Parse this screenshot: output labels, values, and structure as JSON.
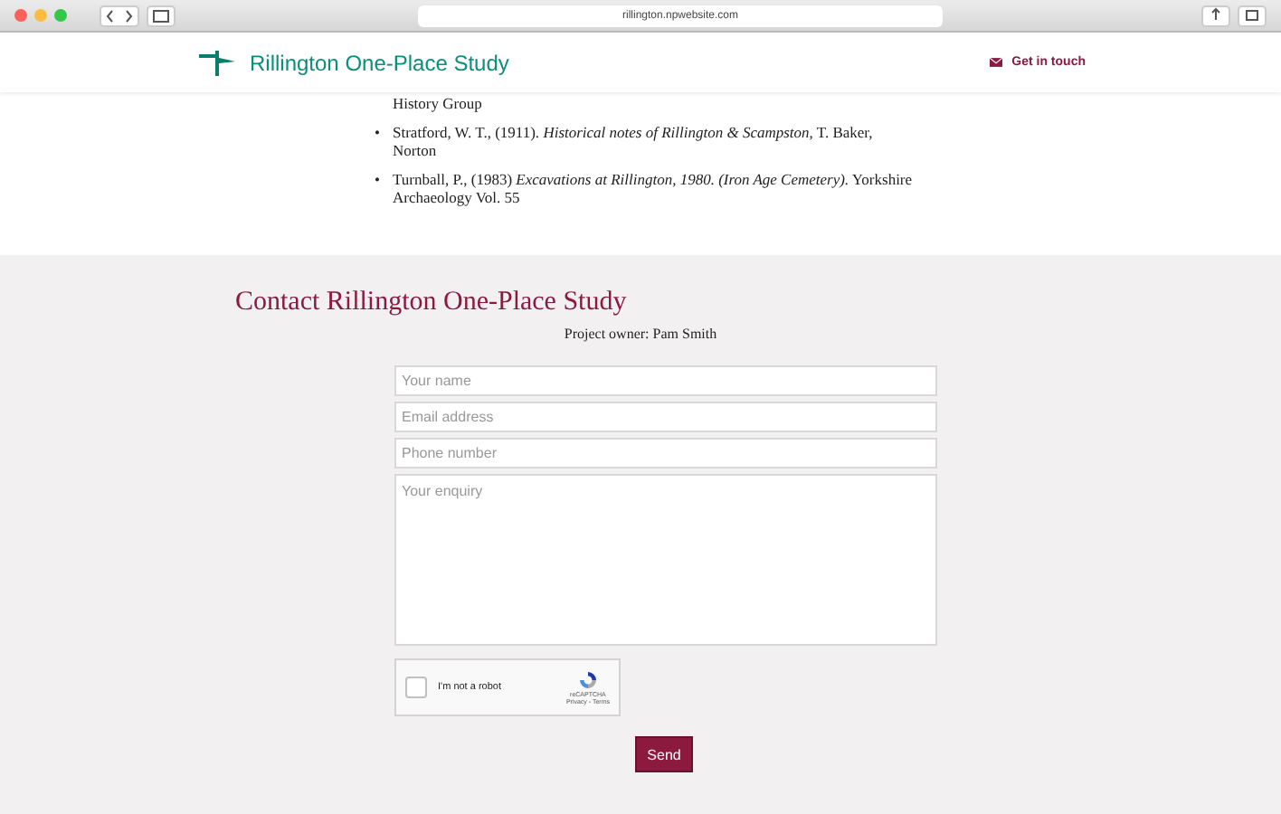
{
  "browser": {
    "address": "rillington.npwebsite.com"
  },
  "header": {
    "site_title": "Rillington One-Place Study",
    "contact_link": "Get in touch"
  },
  "references": [
    {
      "text": "History Group"
    },
    {
      "marker": "•",
      "text": "Stratford, W. T., (1911). *Historical notes of Rillington & Scampston*, T. Baker, Norton"
    },
    {
      "marker": "•",
      "text": "Turnball, P., (1983) *Excavations at Rillington, 1980. (Iron Age Cemetery).* Yorkshire Archaeology Vol. 55"
    }
  ],
  "contact": {
    "title": "Contact Rillington One-Place Study",
    "owner": "Project owner: Pam Smith",
    "fields": [
      {
        "kind": "input",
        "placeholder": "Your name"
      },
      {
        "kind": "input",
        "placeholder": "Email address"
      },
      {
        "kind": "input",
        "placeholder": "Phone number"
      },
      {
        "kind": "textarea",
        "placeholder": "Your enquiry"
      }
    ],
    "captcha": {
      "label": "I'm not a robot",
      "checked": false,
      "brand": "reCAPTCHA",
      "links": "Privacy - Terms"
    },
    "submit": "Send"
  }
}
